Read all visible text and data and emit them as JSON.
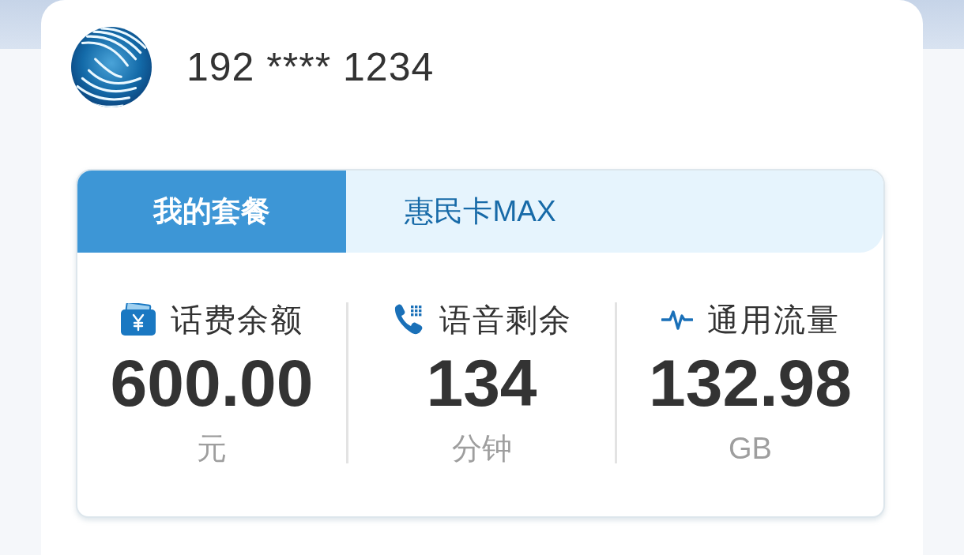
{
  "header": {
    "phone_number": "192 **** 1234"
  },
  "plan_tabs": [
    {
      "label": "我的套餐",
      "selected": true
    },
    {
      "label": "惠民卡MAX",
      "selected": false
    }
  ],
  "stats": [
    {
      "kind": "balance",
      "label": "话费余额",
      "value": "600.00",
      "unit": "元"
    },
    {
      "kind": "voice",
      "label": "语音剩余",
      "value": "134",
      "unit": "分钟"
    },
    {
      "kind": "data",
      "label": "通用流量",
      "value": "132.98",
      "unit": "GB"
    }
  ]
}
